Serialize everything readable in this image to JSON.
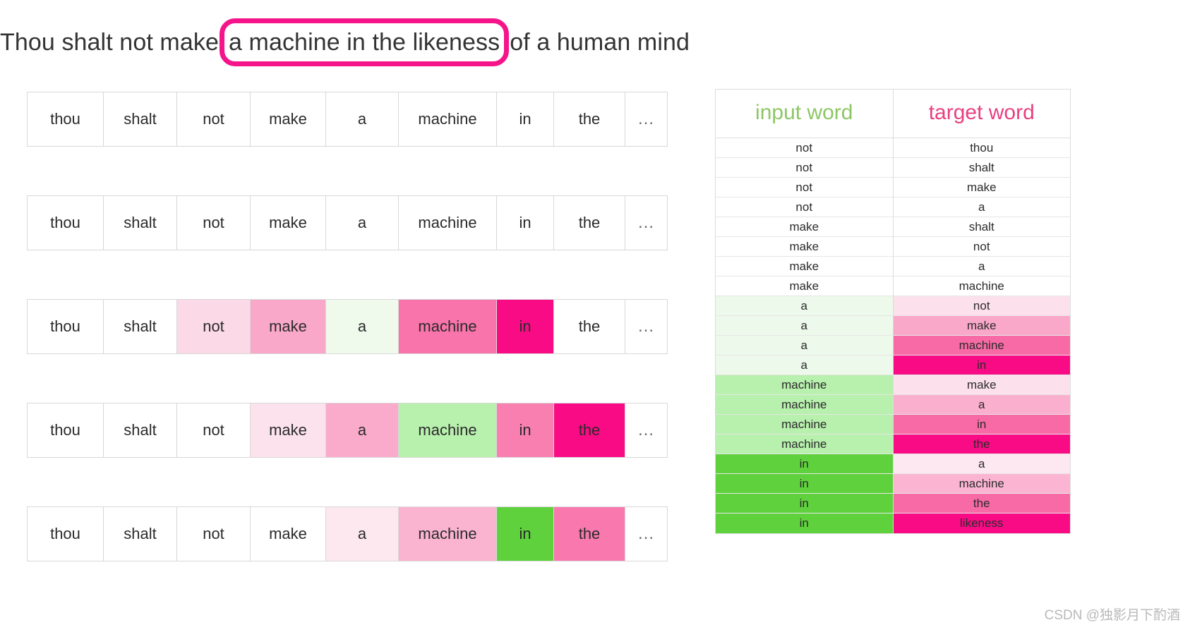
{
  "headline": {
    "before": "Thou shalt not make",
    "highlight": "a machine in the likeness",
    "after": "of a human mind",
    "highlight_color": "#F5148A"
  },
  "palette": {
    "pink_1": "#FDE4EE",
    "pink_2": "#FBD2E2",
    "pink_3": "#FBC2D9",
    "pink_4": "#FA9FC4",
    "pink_5": "#F877AC",
    "pink_6": "#F5559A",
    "pink_vivid": "#F90B86",
    "green_1": "#F0FAEE",
    "green_2": "#E8F7E4",
    "green_3": "#B8F0AD",
    "green_vivid": "#5FD13D",
    "white": "#FFFFFF",
    "header_green": "#8DC765",
    "header_pink": "#E8417F",
    "border": "#D8D8D8"
  },
  "ellipsis": "…",
  "strips": [
    {
      "name": "strip-1",
      "cells": [
        {
          "text": "thou",
          "bg": "#FFFFFF"
        },
        {
          "text": "shalt",
          "bg": "#FFFFFF"
        },
        {
          "text": "not",
          "bg": "#FFFFFF"
        },
        {
          "text": "make",
          "bg": "#FFFFFF"
        },
        {
          "text": "a",
          "bg": "#FFFFFF"
        },
        {
          "text": "machine",
          "bg": "#FFFFFF"
        },
        {
          "text": "in",
          "bg": "#FFFFFF"
        },
        {
          "text": "the",
          "bg": "#FFFFFF"
        },
        {
          "text": "…",
          "bg": "#FFFFFF"
        }
      ]
    },
    {
      "name": "strip-2",
      "cells": [
        {
          "text": "thou",
          "bg": "#FFFFFF"
        },
        {
          "text": "shalt",
          "bg": "#FFFFFF"
        },
        {
          "text": "not",
          "bg": "#FFFFFF"
        },
        {
          "text": "make",
          "bg": "#FFFFFF"
        },
        {
          "text": "a",
          "bg": "#FFFFFF"
        },
        {
          "text": "machine",
          "bg": "#FFFFFF"
        },
        {
          "text": "in",
          "bg": "#FFFFFF"
        },
        {
          "text": "the",
          "bg": "#FFFFFF"
        },
        {
          "text": "…",
          "bg": "#FFFFFF"
        }
      ]
    },
    {
      "name": "strip-3",
      "cells": [
        {
          "text": "thou",
          "bg": "#FFFFFF"
        },
        {
          "text": "shalt",
          "bg": "#FFFFFF"
        },
        {
          "text": "not",
          "bg": "#FBD9E6"
        },
        {
          "text": "make",
          "bg": "#FAA8C9"
        },
        {
          "text": "a",
          "bg": "#EFFAEC"
        },
        {
          "text": "machine",
          "bg": "#F874AB"
        },
        {
          "text": "in",
          "bg": "#F90B86"
        },
        {
          "text": "the",
          "bg": "#FFFFFF"
        },
        {
          "text": "…",
          "bg": "#FFFFFF"
        }
      ]
    },
    {
      "name": "strip-4",
      "cells": [
        {
          "text": "thou",
          "bg": "#FFFFFF"
        },
        {
          "text": "shalt",
          "bg": "#FFFFFF"
        },
        {
          "text": "not",
          "bg": "#FFFFFF"
        },
        {
          "text": "make",
          "bg": "#FCE2EC"
        },
        {
          "text": "a",
          "bg": "#FAABCB"
        },
        {
          "text": "machine",
          "bg": "#B8F0AD"
        },
        {
          "text": "in",
          "bg": "#F97FB1"
        },
        {
          "text": "the",
          "bg": "#F90B86"
        },
        {
          "text": "…",
          "bg": "#FFFFFF"
        }
      ]
    },
    {
      "name": "strip-5",
      "cells": [
        {
          "text": "thou",
          "bg": "#FFFFFF"
        },
        {
          "text": "shalt",
          "bg": "#FFFFFF"
        },
        {
          "text": "not",
          "bg": "#FFFFFF"
        },
        {
          "text": "make",
          "bg": "#FFFFFF"
        },
        {
          "text": "a",
          "bg": "#FDE8F0"
        },
        {
          "text": "machine",
          "bg": "#FAB4D0"
        },
        {
          "text": "in",
          "bg": "#5FD13D"
        },
        {
          "text": "the",
          "bg": "#F979AE"
        },
        {
          "text": "…",
          "bg": "#FFFFFF"
        }
      ]
    }
  ],
  "table": {
    "headers": [
      {
        "label": "input word",
        "color": "#8DC765"
      },
      {
        "label": "target word",
        "color": "#E8417F"
      }
    ],
    "rows": [
      {
        "input": "not",
        "input_bg": "#FFFFFF",
        "target": "thou",
        "target_bg": "#FFFFFF"
      },
      {
        "input": "not",
        "input_bg": "#FFFFFF",
        "target": "shalt",
        "target_bg": "#FFFFFF"
      },
      {
        "input": "not",
        "input_bg": "#FFFFFF",
        "target": "make",
        "target_bg": "#FFFFFF"
      },
      {
        "input": "not",
        "input_bg": "#FFFFFF",
        "target": "a",
        "target_bg": "#FFFFFF"
      },
      {
        "input": "make",
        "input_bg": "#FFFFFF",
        "target": "shalt",
        "target_bg": "#FFFFFF"
      },
      {
        "input": "make",
        "input_bg": "#FFFFFF",
        "target": "not",
        "target_bg": "#FFFFFF"
      },
      {
        "input": "make",
        "input_bg": "#FFFFFF",
        "target": "a",
        "target_bg": "#FFFFFF"
      },
      {
        "input": "make",
        "input_bg": "#FFFFFF",
        "target": "machine",
        "target_bg": "#FFFFFF"
      },
      {
        "input": "a",
        "input_bg": "#EDF9EA",
        "target": "not",
        "target_bg": "#FCE0EC"
      },
      {
        "input": "a",
        "input_bg": "#EDF9EA",
        "target": "make",
        "target_bg": "#FAA8CA"
      },
      {
        "input": "a",
        "input_bg": "#EDF9EA",
        "target": "machine",
        "target_bg": "#F86AA6"
      },
      {
        "input": "a",
        "input_bg": "#EDF9EA",
        "target": "in",
        "target_bg": "#F90B86"
      },
      {
        "input": "machine",
        "input_bg": "#B8F0AD",
        "target": "make",
        "target_bg": "#FCE0EC"
      },
      {
        "input": "machine",
        "input_bg": "#B8F0AD",
        "target": "a",
        "target_bg": "#FAAFCE"
      },
      {
        "input": "machine",
        "input_bg": "#B8F0AD",
        "target": "in",
        "target_bg": "#F86AA6"
      },
      {
        "input": "machine",
        "input_bg": "#B8F0AD",
        "target": "the",
        "target_bg": "#F90B86"
      },
      {
        "input": "in",
        "input_bg": "#5FD13D",
        "target": "a",
        "target_bg": "#FDE7F0"
      },
      {
        "input": "in",
        "input_bg": "#5FD13D",
        "target": "machine",
        "target_bg": "#FBB5D2"
      },
      {
        "input": "in",
        "input_bg": "#5FD13D",
        "target": "the",
        "target_bg": "#F86AA6"
      },
      {
        "input": "in",
        "input_bg": "#5FD13D",
        "target": "likeness",
        "target_bg": "#F90B86"
      }
    ]
  },
  "watermark": "CSDN @独影月下酌酒"
}
